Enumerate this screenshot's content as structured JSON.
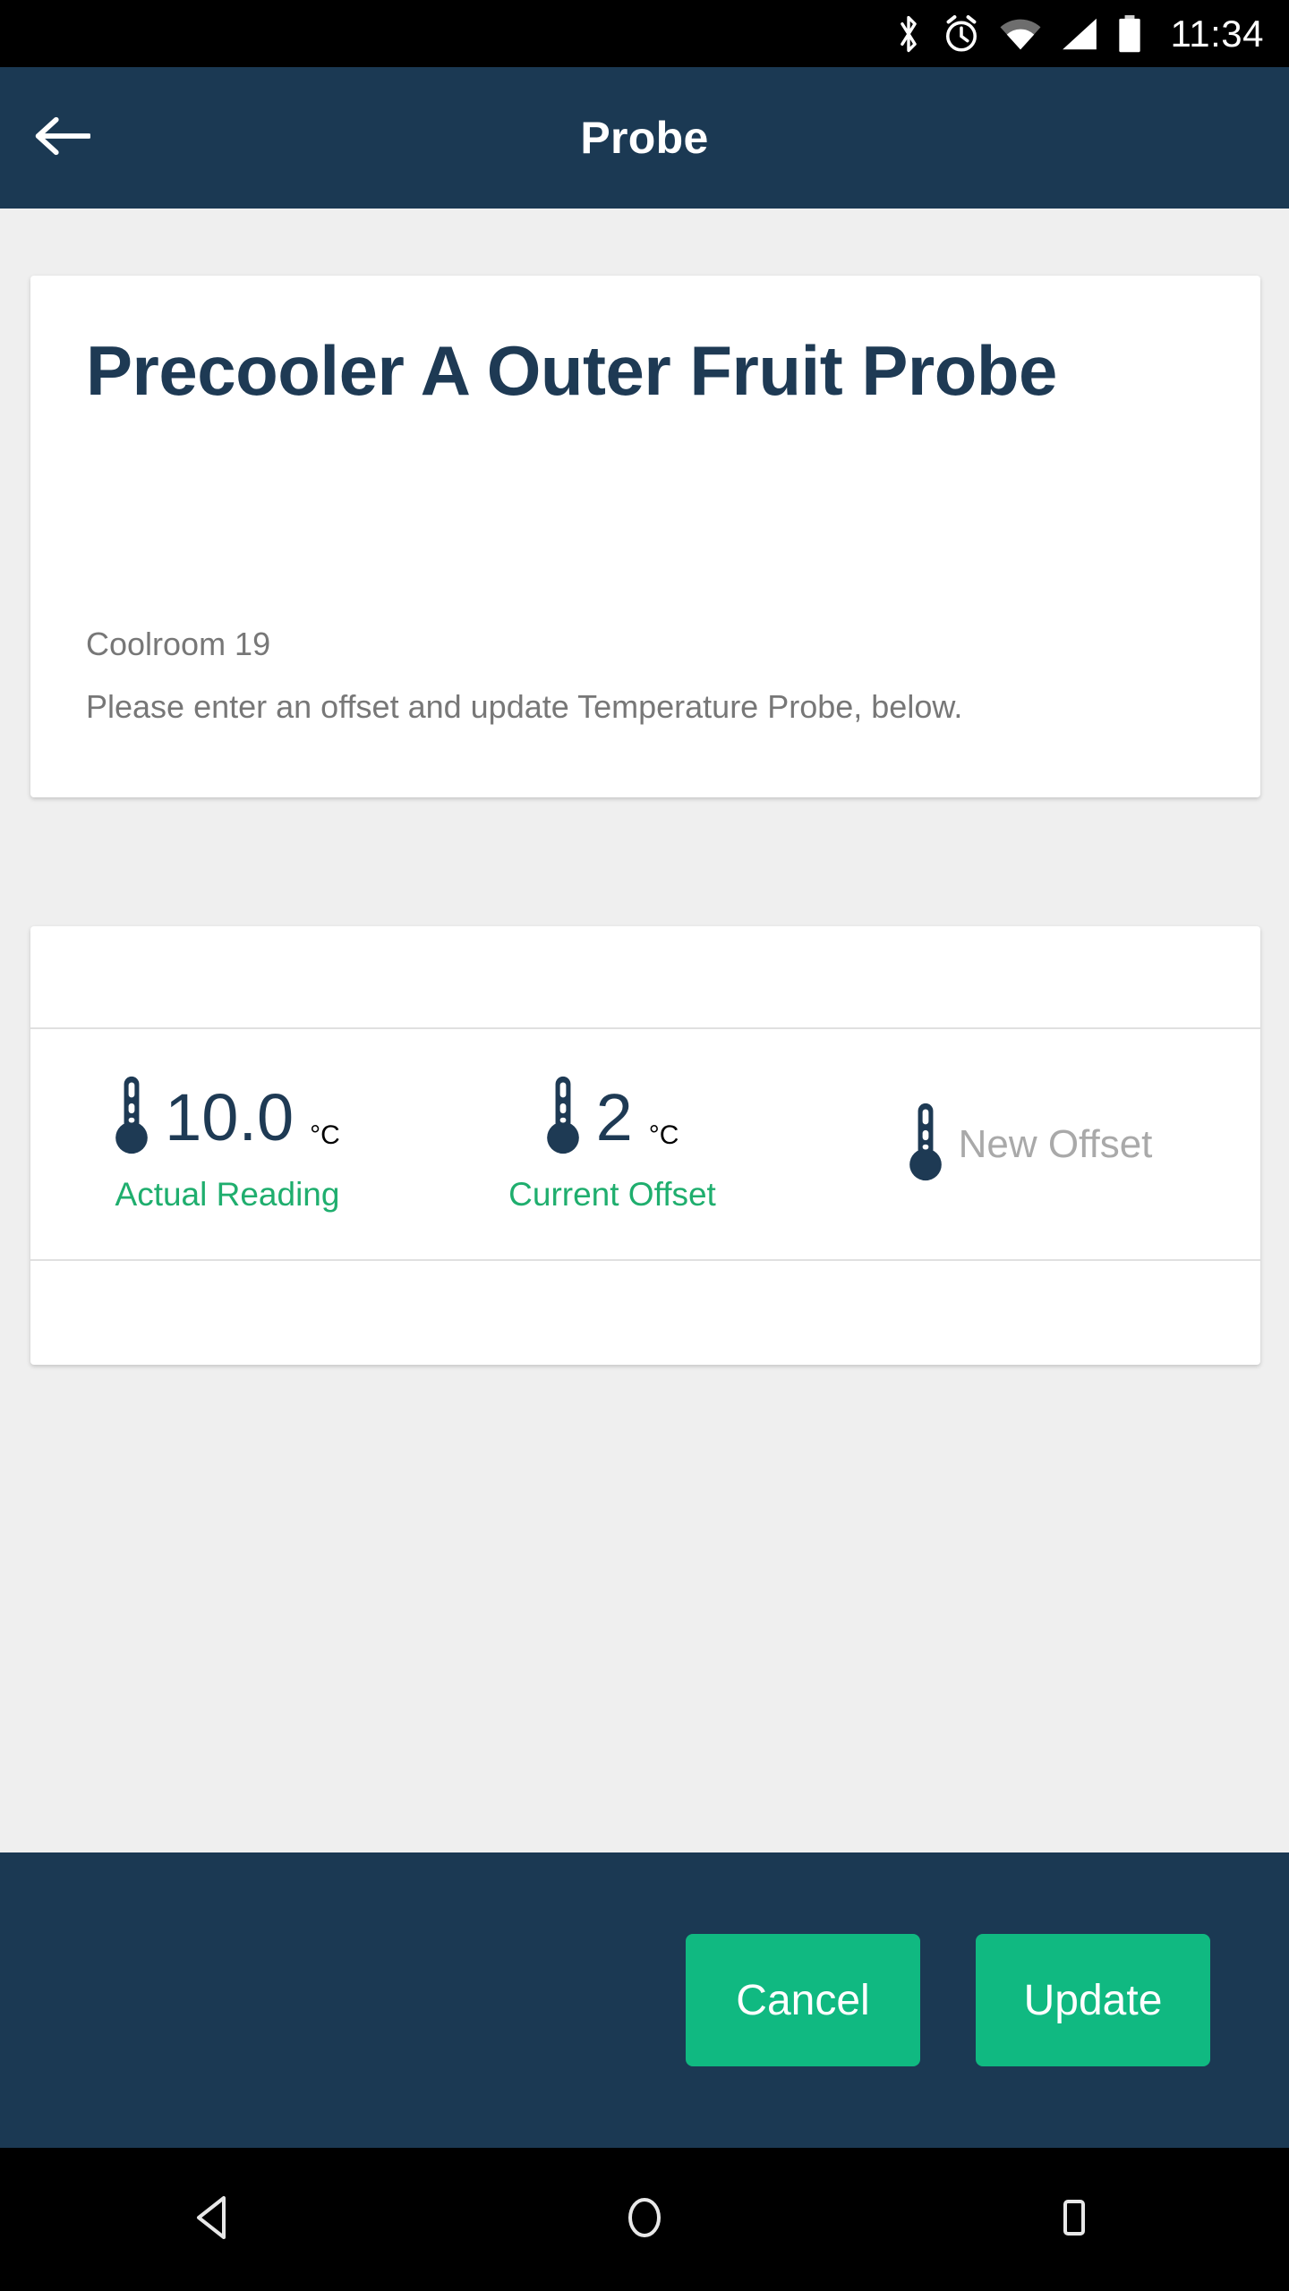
{
  "statusbar": {
    "icons": [
      "bluetooth-icon",
      "alarm-icon",
      "wifi-icon",
      "cellular-signal-icon",
      "battery-icon"
    ],
    "time": "11:34"
  },
  "appbar": {
    "back_icon": "back-arrow-icon",
    "title": "Probe"
  },
  "info_card": {
    "title": "Precooler A Outer Fruit Probe",
    "room": "Coolroom 19",
    "description": "Please enter an offset and update Temperature Probe, below."
  },
  "offset_card": {
    "readings": [
      {
        "icon": "thermometer-icon",
        "value": "10.0",
        "unit_degree": "°",
        "unit_letter": "C",
        "caption": "Actual Reading"
      },
      {
        "icon": "thermometer-icon",
        "value": "2",
        "unit_degree": "°",
        "unit_letter": "C",
        "caption": "Current Offset"
      }
    ],
    "new_offset": {
      "icon": "thermometer-icon",
      "value": "",
      "placeholder": "New Offset"
    }
  },
  "actions": {
    "cancel_label": "Cancel",
    "update_label": "Update"
  },
  "navbar": {
    "back": "nav-back-icon",
    "home": "nav-home-icon",
    "recents": "nav-recents-icon"
  },
  "colors": {
    "primary_dark": "#1b3953",
    "accent_green": "#10b981",
    "caption_green": "#1fae6e",
    "page_background": "#efefef",
    "card_background": "#ffffff",
    "title_text": "#1e3a54",
    "muted_text": "#777777",
    "placeholder_text": "#a9a9a9"
  }
}
